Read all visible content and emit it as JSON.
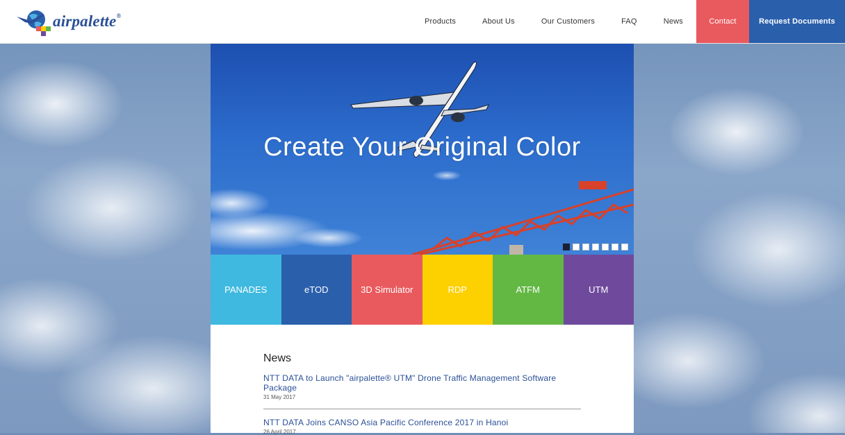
{
  "brand": {
    "logo_text": "airpalette",
    "logo_reg": "®"
  },
  "nav": {
    "items": [
      "Products",
      "About Us",
      "Our Customers",
      "FAQ",
      "News"
    ],
    "contact": "Contact",
    "request": "Request Documents"
  },
  "hero": {
    "headline": "Create Your Original Color",
    "slides": 7,
    "active_slide": 1
  },
  "tiles": [
    {
      "label": "PANADES",
      "color": "#3fb9df"
    },
    {
      "label": "eTOD",
      "color": "#2a5fac"
    },
    {
      "label": "3D Simulator",
      "color": "#e95a5e"
    },
    {
      "label": "RDP",
      "color": "#fdd000"
    },
    {
      "label": "ATFM",
      "color": "#63b844"
    },
    {
      "label": "UTM",
      "color": "#6f4a9c"
    }
  ],
  "news": {
    "heading": "News",
    "items": [
      {
        "title": "NTT DATA to Launch \"airpalette® UTM\" Drone Traffic Management Software Package",
        "date": "31 May 2017"
      },
      {
        "title": "NTT DATA Joins CANSO Asia Pacific Conference 2017 in Hanoi",
        "date": "26 April 2017"
      }
    ]
  },
  "colors": {
    "accent_red": "#e95a5e",
    "accent_blue": "#2a5fac",
    "link": "#2a4f96"
  }
}
